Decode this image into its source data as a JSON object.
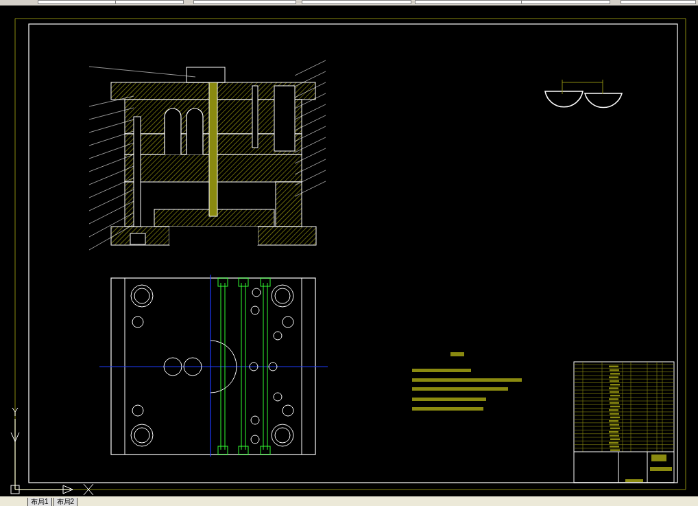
{
  "layout_tabs": [
    {
      "label": "布局1"
    },
    {
      "label": "布局2"
    }
  ]
}
